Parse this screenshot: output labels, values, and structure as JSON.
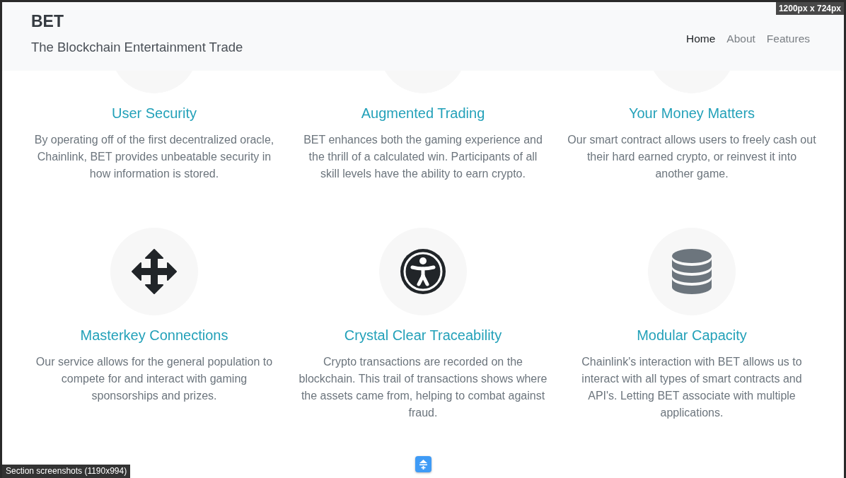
{
  "navbar": {
    "brand": "BET",
    "tagline": "The Blockchain Entertainment Trade",
    "links": [
      {
        "label": "Home",
        "selected": true
      },
      {
        "label": "About",
        "selected": false
      },
      {
        "label": "Features",
        "selected": false
      }
    ]
  },
  "features": [
    {
      "title": "User Security",
      "text": "By operating off of the first decentralized oracle, Chainlink, BET provides unbeatable security in how information is stored."
    },
    {
      "title": "Augmented Trading",
      "text": "BET enhances both the gaming experience and the thrill of a calculated win. Participants of all skill levels have the ability to earn crypto."
    },
    {
      "title": "Your Money Matters",
      "text": "Our smart contract allows users to freely cash out their hard earned crypto, or reinvest it into another game."
    },
    {
      "title": "Masterkey Connections",
      "text": "Our service allows for the general population to compete for and interact with gaming sponsorships and prizes."
    },
    {
      "title": "Crystal Clear Traceability",
      "text": "Crypto transactions are recorded on the blockchain. This trail of transactions shows where the assets came from, helping to combat against fraud."
    },
    {
      "title": "Modular Capacity",
      "text": "Chainlink's interaction with BET allows us to interact with all types of smart contracts and API's. Letting BET associate with multiple applications."
    }
  ],
  "overlays": {
    "size_badge": "1200px x 724px",
    "section_label": "Section screenshots (1190x994)"
  }
}
